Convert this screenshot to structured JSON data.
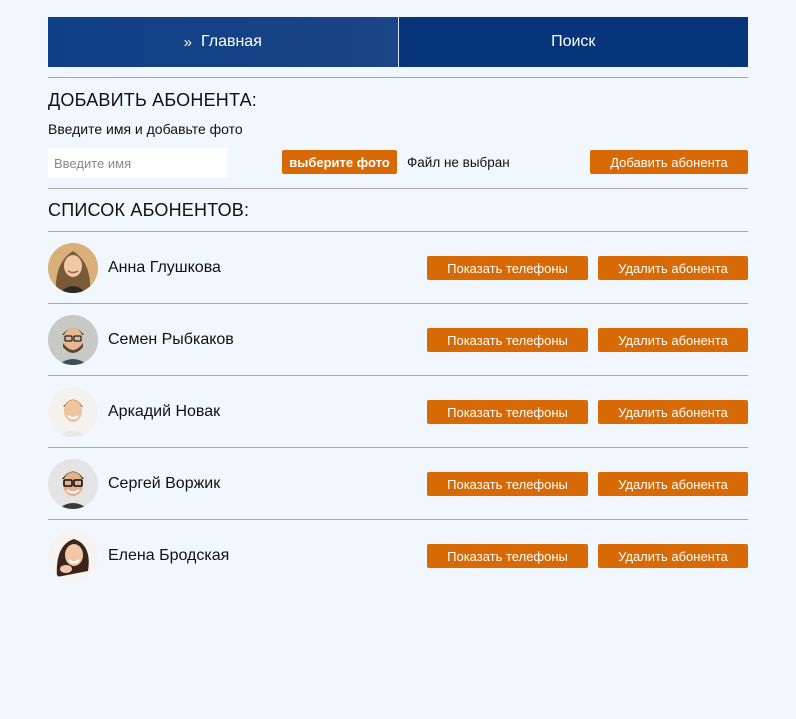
{
  "nav": {
    "home_chevron": "»",
    "home_label": "Главная",
    "search_label": "Поиск"
  },
  "add_section": {
    "title": "ДОБАВИТЬ АБОНЕНТА:",
    "hint": "Введите имя и добавьте фото",
    "name_placeholder": "Введите имя",
    "name_value": "",
    "file_button_label": "выберите фото",
    "file_status": "Файл не выбран",
    "add_button_label": "Добавить абонента"
  },
  "list_section": {
    "title": "СПИСОК АБОНЕНТОВ:",
    "show_phones_label": "Показать телефоны",
    "delete_label": "Удалить абонента",
    "subscribers": [
      {
        "name": "Анна Глушкова",
        "avatar": "avatar-woman-blonde"
      },
      {
        "name": "Семен Рыбкаков",
        "avatar": "avatar-man-glasses-beard"
      },
      {
        "name": "Аркадий Новак",
        "avatar": "avatar-man-smiling"
      },
      {
        "name": "Сергей Воржик",
        "avatar": "avatar-man-glasses"
      },
      {
        "name": "Елена Бродская",
        "avatar": "avatar-woman-brunette"
      }
    ]
  },
  "colors": {
    "background": "#f1f7fd",
    "nav_blue": "#063579",
    "accent_orange": "#d86a05",
    "divider": "#a6a6ab"
  }
}
